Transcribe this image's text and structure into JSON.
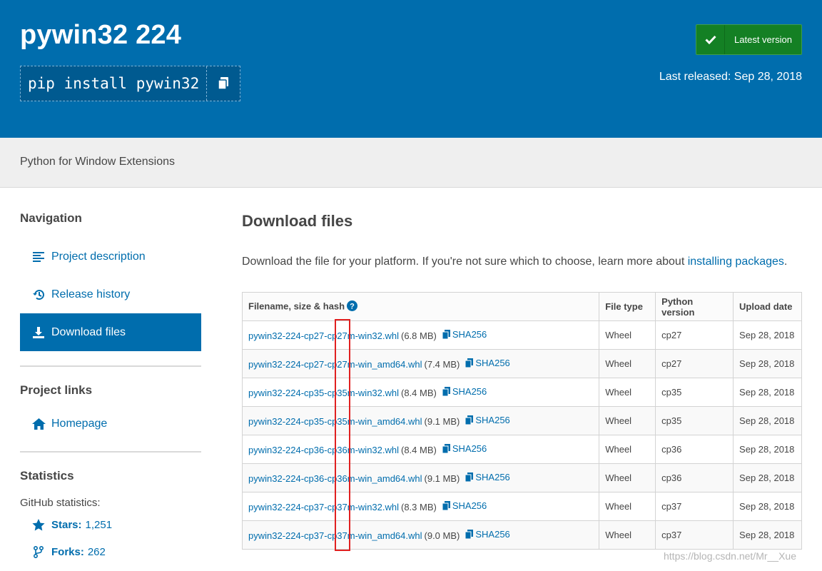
{
  "header": {
    "title": "pywin32 224",
    "pip_command": "pip install pywin32",
    "latest_label": "Latest version",
    "released": "Last released: Sep 28, 2018",
    "colors": {
      "bg": "#006dad",
      "latest": "#148024"
    }
  },
  "summary": "Python for Window Extensions",
  "sidebar": {
    "nav_heading": "Navigation",
    "nav_items": [
      {
        "label": "Project description",
        "icon": "align-left-icon"
      },
      {
        "label": "Release history",
        "icon": "history-icon"
      },
      {
        "label": "Download files",
        "icon": "download-icon",
        "active": true
      }
    ],
    "links_heading": "Project links",
    "homepage_label": "Homepage",
    "stats_heading": "Statistics",
    "github_label": "GitHub statistics:",
    "stars_label": "Stars:",
    "stars_value": "1,251",
    "forks_label": "Forks:",
    "forks_value": "262"
  },
  "main": {
    "heading": "Download files",
    "intro_text": "Download the file for your platform. If you're not sure which to choose, learn more about ",
    "intro_link": "installing packages",
    "intro_end": ".",
    "table": {
      "headers": [
        "Filename, size & hash",
        "File type",
        "Python version",
        "Upload date"
      ],
      "sha_label": "SHA256",
      "rows": [
        {
          "filename": "pywin32-224-cp27-cp27m-win32.whl",
          "size": "(6.8 MB)",
          "type": "Wheel",
          "python": "cp27",
          "date": "Sep 28, 2018"
        },
        {
          "filename": "pywin32-224-cp27-cp27m-win_amd64.whl",
          "size": "(7.4 MB)",
          "type": "Wheel",
          "python": "cp27",
          "date": "Sep 28, 2018"
        },
        {
          "filename": "pywin32-224-cp35-cp35m-win32.whl",
          "size": "(8.4 MB)",
          "type": "Wheel",
          "python": "cp35",
          "date": "Sep 28, 2018"
        },
        {
          "filename": "pywin32-224-cp35-cp35m-win_amd64.whl",
          "size": "(9.1 MB)",
          "type": "Wheel",
          "python": "cp35",
          "date": "Sep 28, 2018"
        },
        {
          "filename": "pywin32-224-cp36-cp36m-win32.whl",
          "size": "(8.4 MB)",
          "type": "Wheel",
          "python": "cp36",
          "date": "Sep 28, 2018"
        },
        {
          "filename": "pywin32-224-cp36-cp36m-win_amd64.whl",
          "size": "(9.1 MB)",
          "type": "Wheel",
          "python": "cp36",
          "date": "Sep 28, 2018"
        },
        {
          "filename": "pywin32-224-cp37-cp37m-win32.whl",
          "size": "(8.3 MB)",
          "type": "Wheel",
          "python": "cp37",
          "date": "Sep 28, 2018"
        },
        {
          "filename": "pywin32-224-cp37-cp37m-win_amd64.whl",
          "size": "(9.0 MB)",
          "type": "Wheel",
          "python": "cp37",
          "date": "Sep 28, 2018"
        }
      ]
    }
  },
  "watermark": "https://blog.csdn.net/Mr__Xue"
}
